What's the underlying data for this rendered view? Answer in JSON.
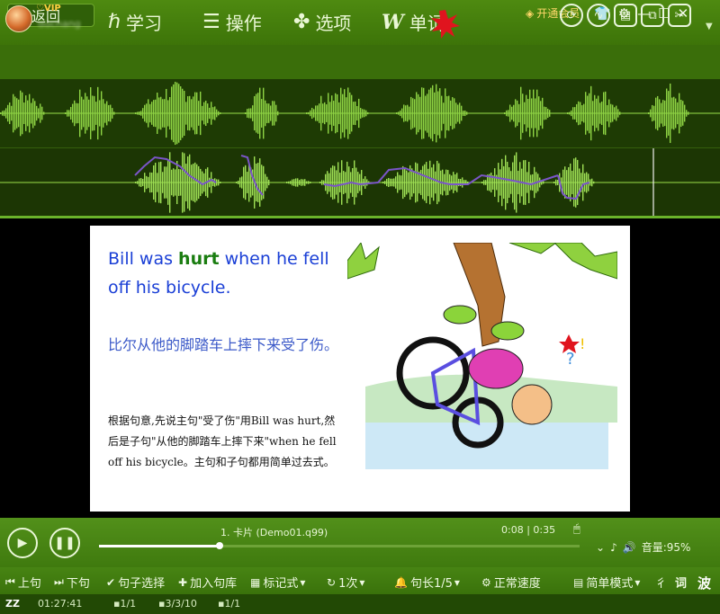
{
  "nav": {
    "back": "返回",
    "learn": "学习",
    "operate": "操作",
    "options": "选项",
    "words": "单词",
    "vip": "开通会员"
  },
  "user": {
    "vip": "VIP",
    "name": "duchang"
  },
  "card": {
    "en_before": "Bill was ",
    "en_highlight": "hurt",
    "en_after": " when he fell off his bicycle.",
    "cn": "比尔从他的脚踏车上摔下来受了伤。",
    "note": "根据句意,先说主句\"受了伤\"用Bill was hurt,然后是子句\"从他的脚踏车上摔下来\"when he fell off his bicycle。主句和子句都用简单过去式。"
  },
  "player": {
    "track": "1. 卡片 (Demo01.q99)",
    "time": "0:08 | 0:35",
    "volume": "音量:95%",
    "progress": 0.25
  },
  "toolbar": {
    "prev": "上句",
    "next": "下句",
    "select": "句子选择",
    "add": "加入句库",
    "mark": "标记式",
    "repeat": "1次",
    "length": "句长1/5",
    "speed": "正常速度",
    "mode": "简单模式",
    "icon1": "彳",
    "word": "词",
    "wave": "波"
  },
  "status": {
    "z": "ZZ",
    "clock": "01:27:41",
    "a": "1/1",
    "b": "3/3/10",
    "c": "1/1"
  },
  "colors": {
    "accent_green": "#4e8a10",
    "english": "#1a3fd6",
    "highlight": "#1a7d10",
    "chinese": "#3b59c8"
  }
}
